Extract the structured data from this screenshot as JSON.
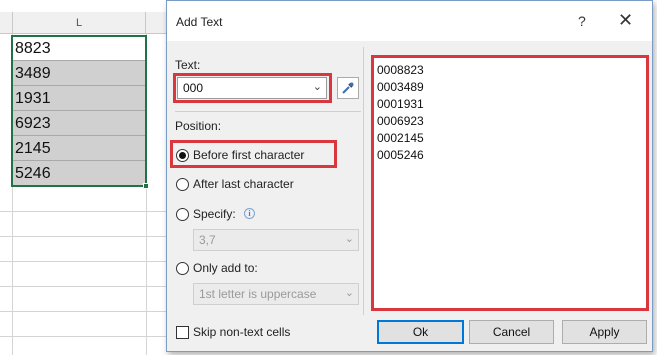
{
  "spreadsheet": {
    "column_header": "L",
    "cells": [
      "8823",
      "3489",
      "1931",
      "6923",
      "2145",
      "5246"
    ]
  },
  "dialog": {
    "title": "Add Text",
    "help_label": "?",
    "close_label": "✕",
    "text_label": "Text:",
    "text_value": "000",
    "position_label": "Position:",
    "options": {
      "before_first": "Before first character",
      "after_last": "After last character",
      "specify": "Specify:",
      "only_add_to": "Only add to:"
    },
    "selected_option": "before_first",
    "specify_value": "3,7",
    "only_add_to_value": "1st letter is uppercase",
    "skip_label": "Skip non-text cells",
    "skip_checked": false,
    "preview_lines": [
      "0008823",
      "0003489",
      "0001931",
      "0006923",
      "0002145",
      "0005246"
    ],
    "buttons": {
      "ok": "Ok",
      "cancel": "Cancel",
      "apply": "Apply"
    }
  },
  "colors": {
    "highlight_red": "#d9363e",
    "excel_green": "#217346",
    "dialog_bg": "#f0f0f0"
  },
  "icons": {
    "picker": "eyedropper-icon",
    "info": "info-icon",
    "dropdown": "chevron-down-icon"
  }
}
